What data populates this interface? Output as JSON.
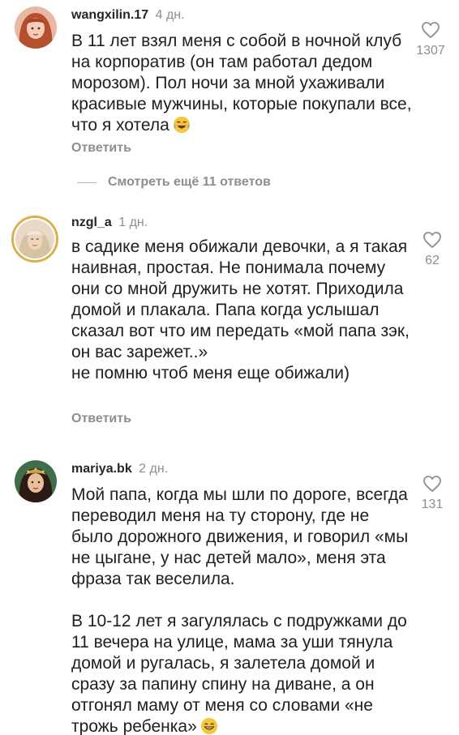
{
  "comments": [
    {
      "username": "wangxilin.17",
      "time": "4 дн.",
      "text": "В 11 лет взял меня с собой в ночной клуб на корпоратив (он там работал дедом морозом). Пол ночи за мной ухаживали красивые мужчины, которые покупали все, что я хотела",
      "emoji": "laughing-tears-emoji",
      "likes": "1307",
      "reply_label": "Ответить"
    },
    {
      "username": "nzgl_a",
      "time": "1 дн.",
      "text": "в садике меня обижали девочки, а я такая наивная, простая. Не понимала почему они со мной дружить не хотят. Приходила домой и плакала. Папа когда услышал сказал вот что им передать «мой папа зэк, он вас зарежет..»\nне помню чтоб меня еще обижали)",
      "likes": "62",
      "reply_label": "Ответить"
    },
    {
      "username": "mariya.bk",
      "time": "2 дн.",
      "text": "Мой папа, когда мы шли по дороге, всегда переводил меня на ту сторону, где не было дорожного движения, и говорил «мы не цыгане, у нас детей мало», меня эта фраза так веселила.\n\nВ 10-12 лет я загулялась с подружками до 11 вечера на улице, мама за уши тянула домой и ругалась, я залетела домой и сразу за папину спину на диване, а он отгонял маму от меня со словами «не трожь ребенка»",
      "emoji": "grinning-emoji",
      "likes": "131"
    }
  ],
  "view_more_label": "Смотреть ещё 11 ответов",
  "colors": {
    "text": "#1f1f1f",
    "muted": "#8e8e8e",
    "story_ring": "#d9b24f"
  },
  "icons": {
    "like": "heart-outline-icon"
  }
}
